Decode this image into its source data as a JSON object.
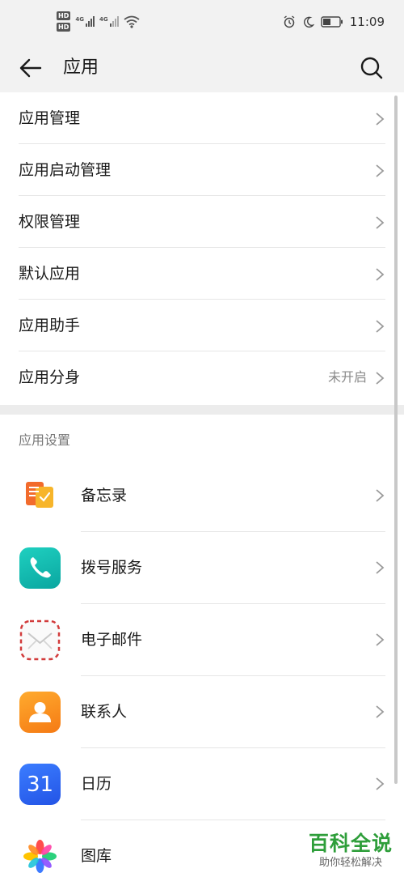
{
  "status_bar": {
    "time": "11:09",
    "hd_label": "HD",
    "net_label": "4G"
  },
  "app_bar": {
    "title": "应用"
  },
  "menu": [
    {
      "label": "应用管理",
      "value": ""
    },
    {
      "label": "应用启动管理",
      "value": ""
    },
    {
      "label": "权限管理",
      "value": ""
    },
    {
      "label": "默认应用",
      "value": ""
    },
    {
      "label": "应用助手",
      "value": ""
    },
    {
      "label": "应用分身",
      "value": "未开启"
    }
  ],
  "app_settings": {
    "header": "应用设置",
    "apps": [
      {
        "label": "备忘录",
        "icon": "notepad-icon"
      },
      {
        "label": "拨号服务",
        "icon": "phone-icon"
      },
      {
        "label": "电子邮件",
        "icon": "mail-icon"
      },
      {
        "label": "联系人",
        "icon": "contacts-icon"
      },
      {
        "label": "日历",
        "icon": "calendar-icon",
        "icon_text": "31"
      },
      {
        "label": "图库",
        "icon": "gallery-icon"
      }
    ]
  },
  "watermark": {
    "title": "百科全说",
    "subtitle": "助你轻松解决"
  }
}
